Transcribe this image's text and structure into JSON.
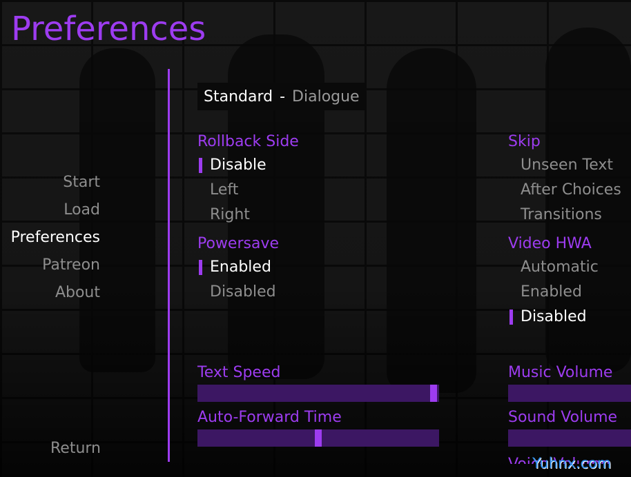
{
  "screen": {
    "title": "Preferences"
  },
  "nav": {
    "items": [
      {
        "label": "Start"
      },
      {
        "label": "Load"
      },
      {
        "label": "Preferences"
      },
      {
        "label": "Patreon"
      },
      {
        "label": "About"
      }
    ],
    "active": "Preferences",
    "return_label": "Return"
  },
  "tabs": {
    "active": "Standard",
    "separator": "-",
    "other": "Dialogue"
  },
  "groups": {
    "rollback": {
      "title": "Rollback Side",
      "options": [
        "Disable",
        "Left",
        "Right"
      ],
      "selected": "Disable"
    },
    "powersave": {
      "title": "Powersave",
      "options": [
        "Enabled",
        "Disabled"
      ],
      "selected": "Enabled"
    },
    "skip": {
      "title": "Skip",
      "options": [
        "Unseen Text",
        "After Choices",
        "Transitions"
      ],
      "selected": ""
    },
    "video_hwa": {
      "title": "Video HWA",
      "options": [
        "Automatic",
        "Enabled",
        "Disabled"
      ],
      "selected": "Disabled"
    }
  },
  "sliders": {
    "text_speed": {
      "label": "Text Speed",
      "value": 0.99
    },
    "auto_forward": {
      "label": "Auto-Forward Time",
      "value": 0.5
    },
    "music_volume": {
      "label": "Music Volume"
    },
    "sound_volume": {
      "label": "Sound Volume"
    },
    "voice_volume": {
      "label": "Voice Volume"
    }
  },
  "watermark": "Yuhnx.com",
  "colors": {
    "accent": "#9d3cf0",
    "bar": "#3c1763",
    "text_idle": "#8e8e8e",
    "text_selected": "#ffffff"
  }
}
